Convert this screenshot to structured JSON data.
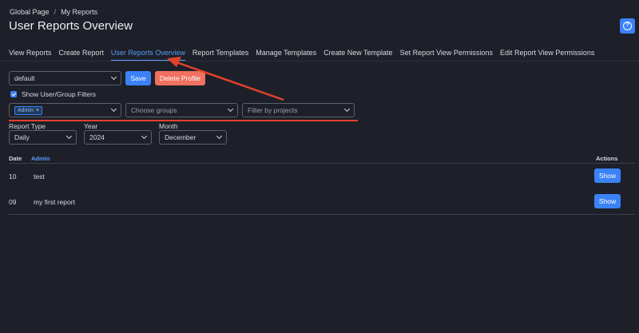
{
  "breadcrumb": {
    "items": [
      "Global Page",
      "My Reports"
    ],
    "separator": "/"
  },
  "page_title": "User Reports Overview",
  "help_icon": "question-circle-icon",
  "tabs": [
    {
      "label": "View Reports",
      "active": false
    },
    {
      "label": "Create Report",
      "active": false
    },
    {
      "label": "User Reports Overview",
      "active": true
    },
    {
      "label": "Report Templates",
      "active": false
    },
    {
      "label": "Manage Templates",
      "active": false
    },
    {
      "label": "Create New Template",
      "active": false
    },
    {
      "label": "Set Report View Permissions",
      "active": false
    },
    {
      "label": "Edit Report View Permissions",
      "active": false
    }
  ],
  "profile": {
    "selected": "default",
    "save_label": "Save",
    "delete_label": "Delete Profile"
  },
  "filters": {
    "show_label": "Show User/Group Filters",
    "show_checked": true,
    "users_tags": [
      {
        "label": "Admin",
        "remove": "×"
      }
    ],
    "groups_placeholder": "Choose groups",
    "projects_placeholder": "Filter by projects"
  },
  "period": {
    "report_type_label": "Report Type",
    "report_type_value": "Daily",
    "year_label": "Year",
    "year_value": "2024",
    "month_label": "Month",
    "month_value": "December"
  },
  "table": {
    "headers": {
      "date": "Date",
      "user": "Admin",
      "actions": "Actions"
    },
    "rows": [
      {
        "date": "10",
        "title": "test",
        "action": "Show"
      },
      {
        "date": "09",
        "title": "my first report",
        "action": "Show"
      }
    ]
  },
  "colors": {
    "background": "#1d2029",
    "accent": "#3b82f6",
    "danger": "#f07160",
    "annotation": "#e3412c"
  }
}
